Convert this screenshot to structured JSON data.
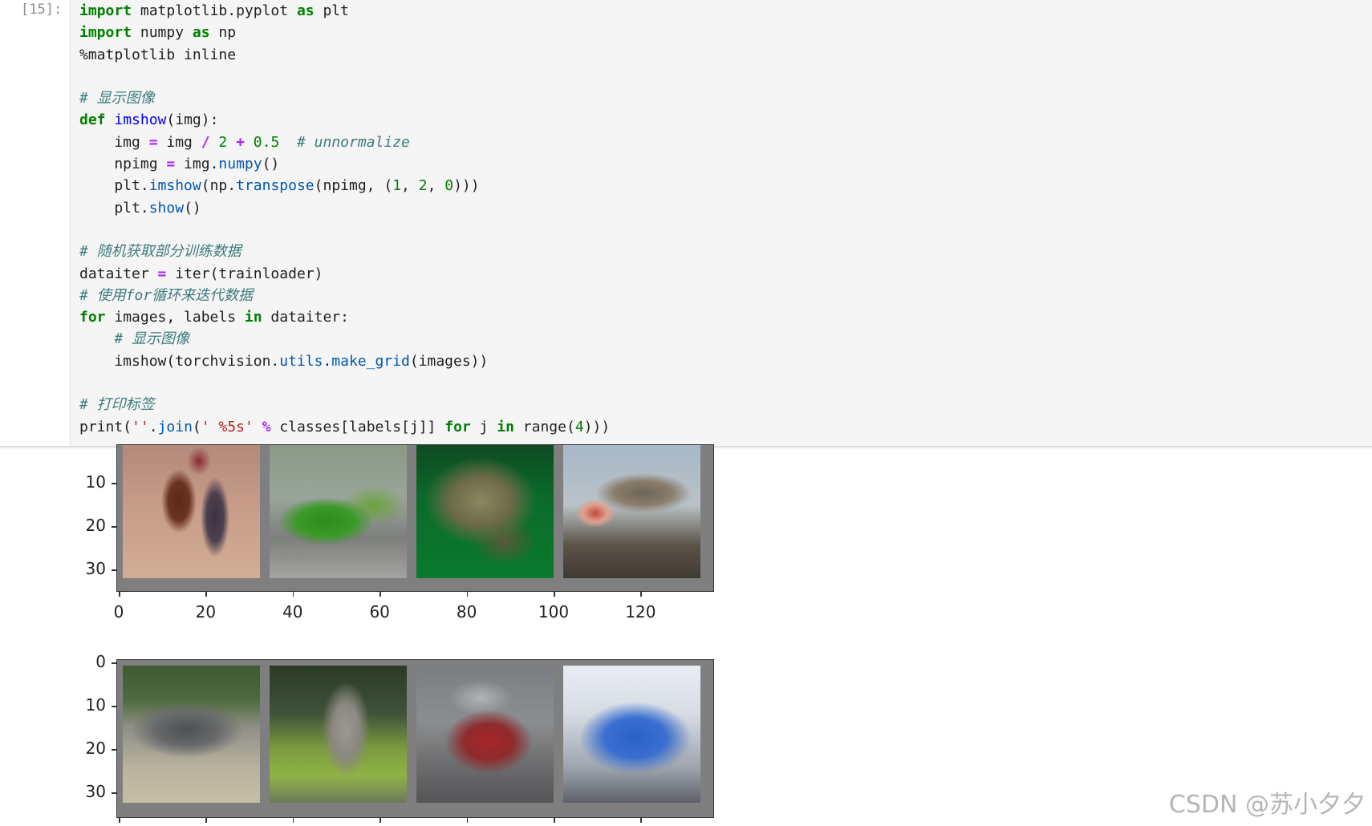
{
  "cell": {
    "prompt": "[15]:",
    "code_lines": [
      [
        {
          "t": "import",
          "c": "kw"
        },
        {
          "t": " matplotlib.pyplot "
        },
        {
          "t": "as",
          "c": "kw"
        },
        {
          "t": " plt"
        }
      ],
      [
        {
          "t": "import",
          "c": "kw"
        },
        {
          "t": " numpy "
        },
        {
          "t": "as",
          "c": "kw"
        },
        {
          "t": " np"
        }
      ],
      [
        {
          "t": "%matplotlib inline"
        }
      ],
      [],
      [
        {
          "t": "# 显示图像",
          "c": "cm"
        }
      ],
      [
        {
          "t": "def",
          "c": "kw"
        },
        {
          "t": " "
        },
        {
          "t": "imshow",
          "c": "fn"
        },
        {
          "t": "(img):"
        }
      ],
      [
        {
          "t": "    img "
        },
        {
          "t": "=",
          "c": "op"
        },
        {
          "t": " img "
        },
        {
          "t": "/",
          "c": "op"
        },
        {
          "t": " "
        },
        {
          "t": "2",
          "c": "num"
        },
        {
          "t": " "
        },
        {
          "t": "+",
          "c": "op"
        },
        {
          "t": " "
        },
        {
          "t": "0.5",
          "c": "num"
        },
        {
          "t": "  "
        },
        {
          "t": "# unnormalize",
          "c": "cm"
        }
      ],
      [
        {
          "t": "    npimg "
        },
        {
          "t": "=",
          "c": "op"
        },
        {
          "t": " img."
        },
        {
          "t": "numpy",
          "c": "at"
        },
        {
          "t": "()"
        }
      ],
      [
        {
          "t": "    plt."
        },
        {
          "t": "imshow",
          "c": "at"
        },
        {
          "t": "(np."
        },
        {
          "t": "transpose",
          "c": "at"
        },
        {
          "t": "(npimg, ("
        },
        {
          "t": "1",
          "c": "num"
        },
        {
          "t": ", "
        },
        {
          "t": "2",
          "c": "num"
        },
        {
          "t": ", "
        },
        {
          "t": "0",
          "c": "num"
        },
        {
          "t": ")))"
        }
      ],
      [
        {
          "t": "    plt."
        },
        {
          "t": "show",
          "c": "at"
        },
        {
          "t": "()"
        }
      ],
      [],
      [
        {
          "t": "# 随机获取部分训练数据",
          "c": "cm"
        }
      ],
      [
        {
          "t": "dataiter "
        },
        {
          "t": "=",
          "c": "op"
        },
        {
          "t": " iter(trainloader)"
        }
      ],
      [
        {
          "t": "# 使用for循环来迭代数据",
          "c": "cm"
        }
      ],
      [
        {
          "t": "for",
          "c": "kw"
        },
        {
          "t": " images, labels "
        },
        {
          "t": "in",
          "c": "kw"
        },
        {
          "t": " dataiter:"
        }
      ],
      [
        {
          "t": "    "
        },
        {
          "t": "# 显示图像",
          "c": "cm"
        }
      ],
      [
        {
          "t": "    imshow(torchvision."
        },
        {
          "t": "utils",
          "c": "at"
        },
        {
          "t": "."
        },
        {
          "t": "make_grid",
          "c": "at"
        },
        {
          "t": "(images))"
        }
      ],
      [],
      [
        {
          "t": "# 打印标签",
          "c": "cm"
        }
      ],
      [
        {
          "t": "print("
        },
        {
          "t": "''",
          "c": "st"
        },
        {
          "t": "."
        },
        {
          "t": "join",
          "c": "at"
        },
        {
          "t": "("
        },
        {
          "t": "' %5s'",
          "c": "st"
        },
        {
          "t": " "
        },
        {
          "t": "%",
          "c": "op"
        },
        {
          "t": " classes[labels[j]] "
        },
        {
          "t": "for",
          "c": "kw"
        },
        {
          "t": " j "
        },
        {
          "t": "in",
          "c": "kw"
        },
        {
          "t": " range("
        },
        {
          "t": "4",
          "c": "num"
        },
        {
          "t": ")))"
        }
      ]
    ]
  },
  "output": {
    "plot1": {
      "ytick_labels": [
        "10",
        "20",
        "30"
      ],
      "xtick_labels": [
        "0",
        "20",
        "40",
        "60",
        "80",
        "100",
        "120"
      ],
      "images": [
        "horse-rider-image",
        "green-truck-image",
        "frog-image",
        "airplane-image"
      ]
    },
    "plot2": {
      "ytick_labels": [
        "0",
        "10",
        "20",
        "30"
      ],
      "images": [
        "car-image",
        "deer-image",
        "fire-truck-image",
        "blue-truck-image"
      ]
    }
  },
  "watermark": "CSDN @苏小夕夕"
}
